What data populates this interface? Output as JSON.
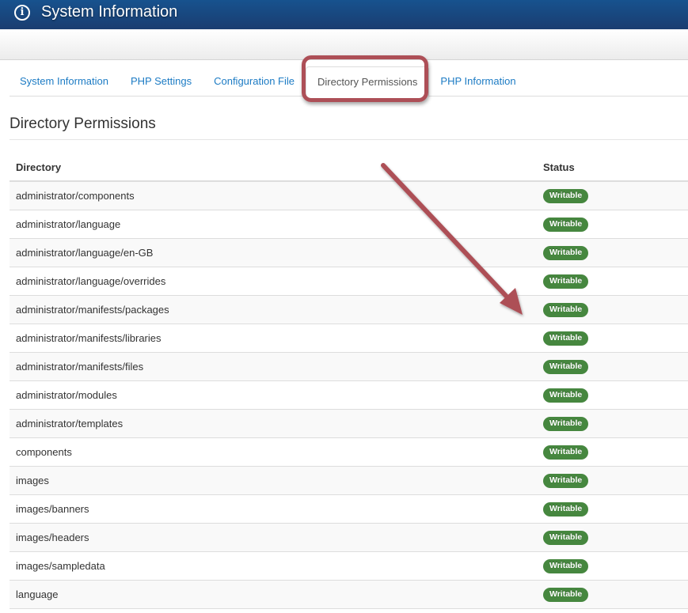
{
  "header": {
    "icon": "info-icon",
    "title": "System Information"
  },
  "tabs": [
    {
      "label": "System Information",
      "active": false
    },
    {
      "label": "PHP Settings",
      "active": false
    },
    {
      "label": "Configuration File",
      "active": false
    },
    {
      "label": "Directory Permissions",
      "active": true
    },
    {
      "label": "PHP Information",
      "active": false
    }
  ],
  "page": {
    "title": "Directory Permissions"
  },
  "table": {
    "columns": [
      "Directory",
      "Status"
    ],
    "rows": [
      {
        "directory": "administrator/components",
        "status": "Writable"
      },
      {
        "directory": "administrator/language",
        "status": "Writable"
      },
      {
        "directory": "administrator/language/en-GB",
        "status": "Writable"
      },
      {
        "directory": "administrator/language/overrides",
        "status": "Writable"
      },
      {
        "directory": "administrator/manifests/packages",
        "status": "Writable"
      },
      {
        "directory": "administrator/manifests/libraries",
        "status": "Writable"
      },
      {
        "directory": "administrator/manifests/files",
        "status": "Writable"
      },
      {
        "directory": "administrator/modules",
        "status": "Writable"
      },
      {
        "directory": "administrator/templates",
        "status": "Writable"
      },
      {
        "directory": "components",
        "status": "Writable"
      },
      {
        "directory": "images",
        "status": "Writable"
      },
      {
        "directory": "images/banners",
        "status": "Writable"
      },
      {
        "directory": "images/headers",
        "status": "Writable"
      },
      {
        "directory": "images/sampledata",
        "status": "Writable"
      },
      {
        "directory": "language",
        "status": "Writable"
      }
    ]
  },
  "colors": {
    "header_bg": "#1a4a85",
    "link": "#1c7bc4",
    "badge_success": "#46873f",
    "annotation": "#ad4f57"
  }
}
